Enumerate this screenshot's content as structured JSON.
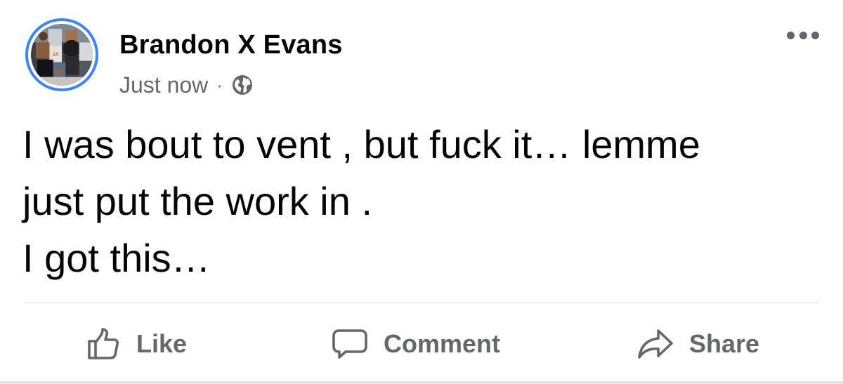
{
  "post": {
    "author": "Brandon X Evans",
    "timestamp": "Just now",
    "separator": "·",
    "audience_icon": "globe-icon",
    "avatar_ring_color": "#3d86f0",
    "text_lines": [
      "I was bout to vent , but fuck it… lemme",
      "just put the work in .",
      "I got this…"
    ],
    "more_icon": "more-options-icon"
  },
  "actions": {
    "like_label": "Like",
    "like_icon": "thumbs-up-icon",
    "comment_label": "Comment",
    "comment_icon": "speech-bubble-icon",
    "share_label": "Share",
    "share_icon": "share-arrow-icon"
  },
  "colors": {
    "primary_text": "#050505",
    "secondary_text": "#65676b",
    "divider": "#dddfe2"
  }
}
